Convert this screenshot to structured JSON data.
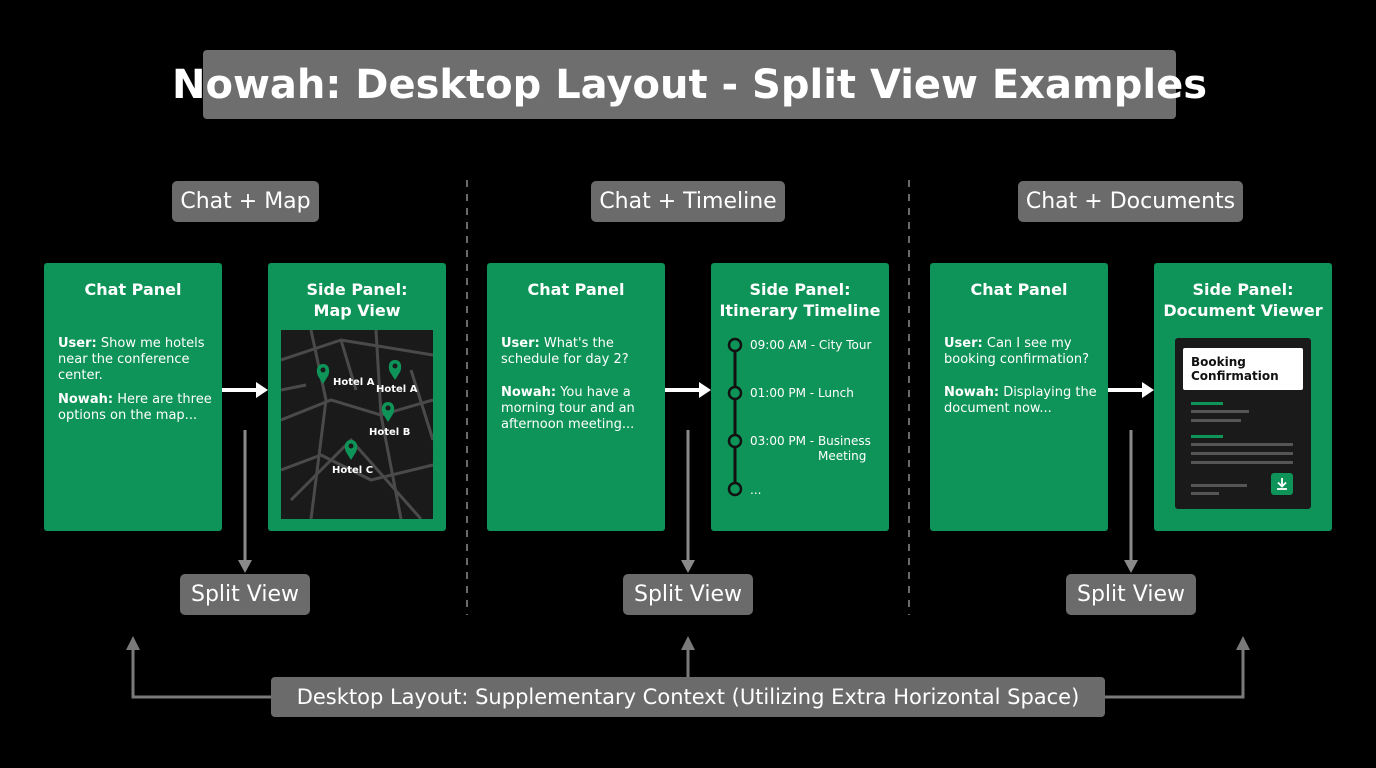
{
  "title": "Nowah: Desktop Layout - Split View Examples",
  "sections": [
    {
      "label": "Chat + Map",
      "chat_title": "Chat Panel",
      "chat_messages": [
        {
          "speaker": "User:",
          "text": "Show me hotels near the conference center."
        },
        {
          "speaker": "Nowah:",
          "text": "Here are three options on the map..."
        }
      ],
      "side_title_line1": "Side Panel:",
      "side_title_line2": "Map View",
      "map_pins": [
        "Hotel A",
        "Hotel A",
        "Hotel B",
        "Hotel C"
      ],
      "split_label": "Split View"
    },
    {
      "label": "Chat + Timeline",
      "chat_title": "Chat Panel",
      "chat_messages": [
        {
          "speaker": "User:",
          "text": "What's the schedule for day 2?"
        },
        {
          "speaker": "Nowah:",
          "text": "You have a morning tour and an afternoon meeting..."
        }
      ],
      "side_title_line1": "Side Panel:",
      "side_title_line2": "Itinerary Timeline",
      "timeline": [
        {
          "line1": "09:00 AM - City Tour",
          "line2": ""
        },
        {
          "line1": "01:00 PM - Lunch",
          "line2": ""
        },
        {
          "line1": "03:00 PM - Business",
          "line2": "Meeting"
        },
        {
          "line1": "...",
          "line2": ""
        }
      ],
      "split_label": "Split View"
    },
    {
      "label": "Chat + Documents",
      "chat_title": "Chat Panel",
      "chat_messages": [
        {
          "speaker": "User:",
          "text": "Can I see my booking confirmation?"
        },
        {
          "speaker": "Nowah:",
          "text": "Displaying the document now..."
        }
      ],
      "side_title_line1": "Side Panel:",
      "side_title_line2": "Document Viewer",
      "doc_card_line1": "Booking",
      "doc_card_line2": "Confirmation",
      "split_label": "Split View"
    }
  ],
  "bottom_label": "Desktop Layout: Supplementary Context (Utilizing Extra Horizontal Space)",
  "colors": {
    "background": "#000000",
    "panel": "#0e9458",
    "label_box": "#6b6b6b",
    "arrow": "#ffffff",
    "connector": "#7a7a7a"
  },
  "icons": {
    "map_pin": "map-pin-icon",
    "download": "download-icon",
    "arrow": "arrow-right-icon"
  }
}
